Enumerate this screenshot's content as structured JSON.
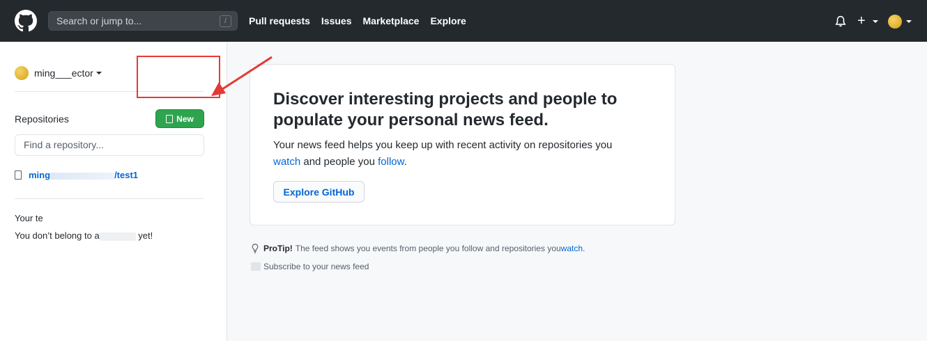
{
  "header": {
    "search_placeholder": "Search or jump to...",
    "search_shortcut": "/",
    "nav": [
      "Pull requests",
      "Issues",
      "Marketplace",
      "Explore"
    ],
    "plus_label": "+"
  },
  "sidebar": {
    "context_name": "ming___ector",
    "repositories_heading": "Repositories",
    "new_button_label": "New",
    "find_placeholder": "Find a repository...",
    "repo_prefix": "ming",
    "repo_suffix": "/test1",
    "teams_heading": "Your te",
    "teams_empty_a": "You don’t belong to a",
    "teams_empty_b": " yet!"
  },
  "main": {
    "card_title": "Discover interesting projects and people to populate your personal news feed.",
    "card_text_a": "Your news feed helps you keep up with recent activity on repositories you",
    "card_link_watch": "watch",
    "card_text_b": " and people you ",
    "card_link_follow": "follow",
    "card_text_c": ".",
    "explore_button": "Explore GitHub",
    "protip_label": "ProTip!",
    "protip_text": " The feed shows you events from people you follow and repositories you ",
    "protip_link": "watch",
    "protip_end": ".",
    "subscribe": "Subscribe to your news feed"
  },
  "colors": {
    "header_bg": "#24292e",
    "primary_green": "#2ea44f",
    "link_blue": "#0366d6",
    "annotation_red": "#e53935"
  }
}
